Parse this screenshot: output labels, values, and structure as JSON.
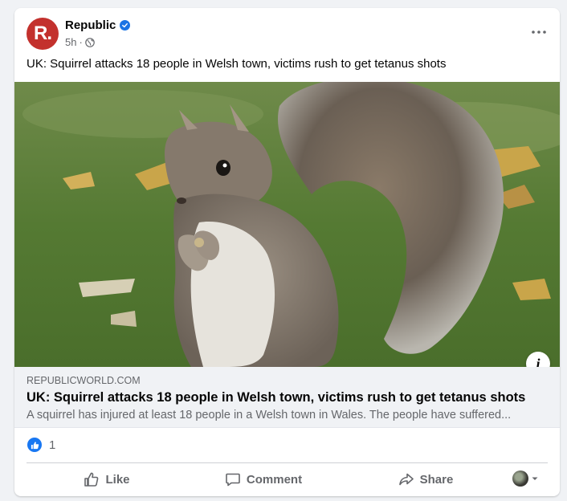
{
  "post": {
    "page_name": "Republic",
    "avatar_letter": "R.",
    "time": "5h",
    "separator": "·",
    "caption": "UK: Squirrel attacks 18 people in Welsh town, victims rush to get tetanus shots"
  },
  "link": {
    "domain": "REPUBLICWORLD.COM",
    "title": "UK: Squirrel attacks 18 people in Welsh town, victims rush to get tetanus shots",
    "description": "A squirrel has injured at least 18 people in a Welsh town in Wales. The people have suffered..."
  },
  "reactions": {
    "count": "1"
  },
  "actions": {
    "like": "Like",
    "comment": "Comment",
    "share": "Share"
  },
  "icons": {
    "verified": "verified-badge-icon",
    "globe": "globe-icon",
    "more": "more-dots-icon",
    "info": "info-icon",
    "like_reaction": "thumbs-up-icon"
  },
  "colors": {
    "brand_red": "#c3312d",
    "facebook_blue": "#1877f2",
    "secondary_text": "#65676b",
    "preview_bg": "#f0f2f5"
  }
}
